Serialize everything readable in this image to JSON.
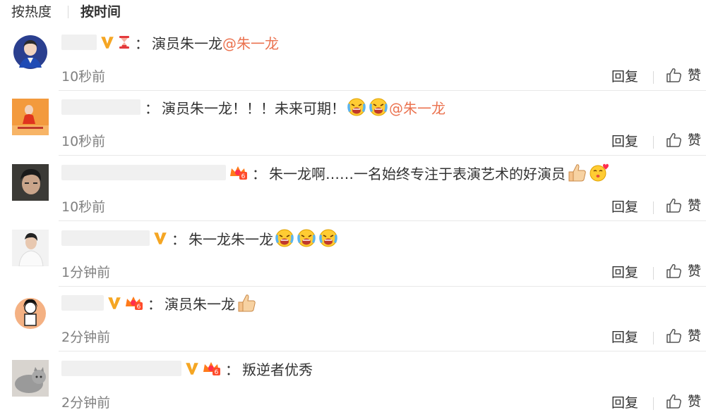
{
  "sort": {
    "hot_label": "按热度",
    "time_label": "按时间"
  },
  "comments": [
    {
      "text": "演员朱一龙",
      "mention": "@朱一龙",
      "time": "10秒前"
    },
    {
      "text": "演员朱一龙！！！未来可期！",
      "mention": "@朱一龙",
      "time": "10秒前"
    },
    {
      "text": "朱一龙啊……一名始终专注于表演艺术的好演员",
      "mention": "",
      "time": "10秒前"
    },
    {
      "text": "朱一龙朱一龙",
      "mention": "",
      "time": "1分钟前"
    },
    {
      "text": "演员朱一龙",
      "mention": "",
      "time": "2分钟前"
    },
    {
      "text": "叛逆者优秀",
      "mention": "",
      "time": "2分钟前"
    }
  ],
  "actions": {
    "reply_label": "回复",
    "like_label": "赞"
  },
  "icons": {
    "verified": "verified-v-icon",
    "hourglass": "hourglass-icon",
    "fan_badge": "fan-badge-icon",
    "emoji_laugh_cry": "laugh-cry-emoji-icon",
    "emoji_thumbs": "thumbs-up-emoji-icon",
    "emoji_kiss": "kiss-heart-emoji-icon",
    "like": "thumbs-up-icon"
  },
  "colors": {
    "mention": "#eb7350",
    "verified": "#f5a623",
    "time": "#808080",
    "text": "#333333"
  }
}
